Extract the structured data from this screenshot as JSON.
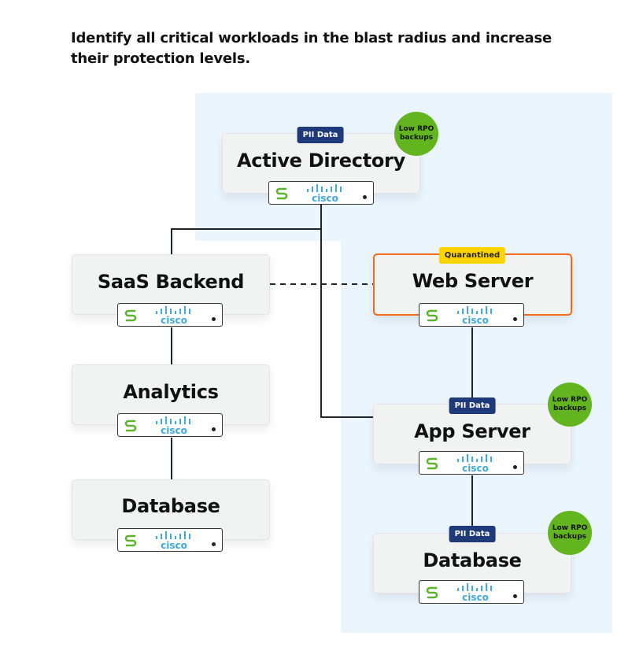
{
  "instruction": "Identify all critical workloads in the blast radius and increase their protection levels.",
  "colors": {
    "blast_zone": "#eaf5fe",
    "card_bg": "#f1f2f2",
    "pii_badge": "#1f3a7a",
    "quarantine_badge": "#ffd400",
    "quarantine_border": "#f26a1b",
    "rpo_circle": "#62b51e",
    "cisco_blue": "#3fa9d9",
    "s_logo_green": "#5bb42a",
    "connector": "#1e2329"
  },
  "nodes": {
    "active_directory": {
      "title": "Active Directory",
      "badge": "PII Data",
      "rpo": "Low RPO backups",
      "in_blast_radius": true
    },
    "saas_backend": {
      "title": "SaaS Backend",
      "in_blast_radius": false
    },
    "web_server": {
      "title": "Web Server",
      "badge": "Quarantined",
      "status": "quarantined",
      "in_blast_radius": true
    },
    "analytics": {
      "title": "Analytics",
      "in_blast_radius": false
    },
    "database_left": {
      "title": "Database",
      "in_blast_radius": false
    },
    "app_server": {
      "title": "App Server",
      "badge": "PII Data",
      "rpo": "Low RPO backups",
      "in_blast_radius": true
    },
    "database_right": {
      "title": "Database",
      "badge": "PII Data",
      "rpo": "Low RPO backups",
      "in_blast_radius": true
    }
  },
  "strip": {
    "s_logo": "s-logo-icon",
    "vendor_logo": "cisco-logo",
    "indicator": "status-dot"
  },
  "edges": [
    {
      "from": "Active Directory",
      "to": "SaaS Backend",
      "style": "solid"
    },
    {
      "from": "Active Directory",
      "to": "App Server",
      "style": "solid"
    },
    {
      "from": "SaaS Backend",
      "to": "Web Server",
      "style": "dashed"
    },
    {
      "from": "SaaS Backend",
      "to": "Analytics",
      "style": "solid"
    },
    {
      "from": "Analytics",
      "to": "Database",
      "style": "solid"
    },
    {
      "from": "Web Server",
      "to": "App Server",
      "style": "solid"
    },
    {
      "from": "App Server",
      "to": "Database",
      "style": "solid"
    }
  ]
}
